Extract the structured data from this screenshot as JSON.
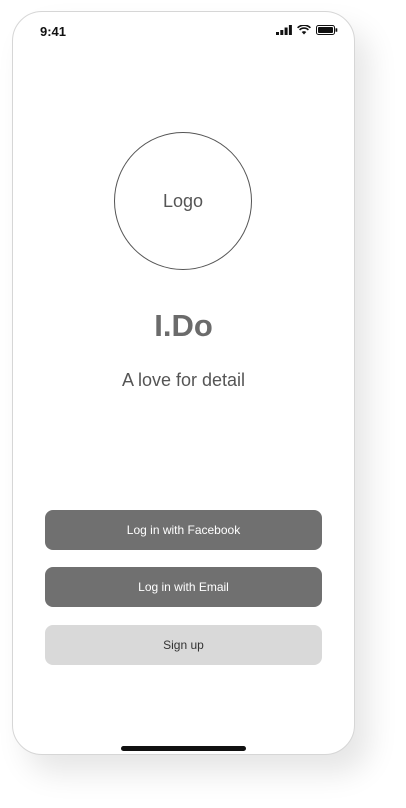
{
  "status_bar": {
    "time": "9:41",
    "icons": [
      "signal-icon",
      "wifi-icon",
      "battery-icon"
    ]
  },
  "logo": {
    "label": "Logo"
  },
  "app": {
    "title": "I.Do",
    "tagline": "A love for detail"
  },
  "actions": {
    "facebook_label": "Log in with Facebook",
    "email_label": "Log in with Email",
    "signup_label": "Sign up"
  },
  "colors": {
    "dark_button": "#707070",
    "light_button": "#d9d9d9",
    "title_text": "#6b6b6b"
  }
}
